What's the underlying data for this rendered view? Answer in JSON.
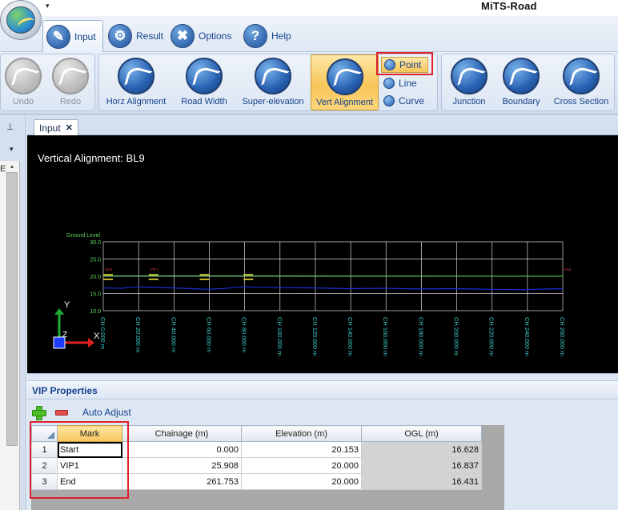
{
  "app": {
    "title": "MiTS-Road",
    "qat_icon": "dropdown-arrow"
  },
  "tabs": [
    {
      "label": "Input",
      "icon": "pencil-doc-icon",
      "active": true
    },
    {
      "label": "Result",
      "icon": "gear-icon",
      "active": false
    },
    {
      "label": "Options",
      "icon": "tools-icon",
      "active": false
    },
    {
      "label": "Help",
      "icon": "question-icon",
      "active": false
    }
  ],
  "ribbon": {
    "undo": "Undo",
    "redo": "Redo",
    "horz_alignment": "Horz Alignment",
    "road_width": "Road Width",
    "super_elevation": "Super-elevation",
    "vert_alignment": "Vert Alignment",
    "point": "Point",
    "line": "Line",
    "curve": "Curve",
    "junction": "Junction",
    "boundary": "Boundary",
    "cross_section": "Cross Section"
  },
  "left_panel": {
    "pin": "ᵖ",
    "letter": "E"
  },
  "doc_tab": {
    "label": "Input",
    "close": "✕"
  },
  "canvas": {
    "title": "Vertical Alignment: BL9",
    "ground_level_label": "Ground Level",
    "y_ticks": [
      "30.0",
      "25.0",
      "20.0",
      "15.0",
      "10.0"
    ],
    "x_ticks": [
      "CH 0.000 m",
      "CH 20.000 m",
      "CH 40.000 m",
      "CH 60.000 m",
      "CH 80.000 m",
      "CH 100.000 m",
      "CH 120.000 m",
      "CH 140.000 m",
      "CH 160.000 m",
      "CH 180.000 m",
      "CH 200.000 m",
      "CH 220.000 m",
      "CH 240.000 m",
      "CH 260.000 m"
    ],
    "vip_labels": [
      "Start",
      "VIP1",
      "End"
    ],
    "axis_y": "Y",
    "axis_x": "X",
    "axis_z": "Z",
    "colors": {
      "background": "#000000",
      "grid": "#d9d9d9",
      "ground_line": "#1a2fd0",
      "design_line": "#5fd35f",
      "markers": "#f5e43a",
      "ticks": "#3fd0d0"
    }
  },
  "vip": {
    "header": "VIP Properties",
    "auto_adjust": "Auto Adjust",
    "columns": [
      "Mark",
      "Chainage (m)",
      "Elevation (m)",
      "OGL (m)"
    ],
    "rows": [
      {
        "n": "1",
        "mark": "Start",
        "chainage": "0.000",
        "elevation": "20.153",
        "ogl": "16.628"
      },
      {
        "n": "2",
        "mark": "VIP1",
        "chainage": "25.908",
        "elevation": "20.000",
        "ogl": "16.837"
      },
      {
        "n": "3",
        "mark": "End",
        "chainage": "261.753",
        "elevation": "20.000",
        "ogl": "16.431"
      }
    ]
  }
}
